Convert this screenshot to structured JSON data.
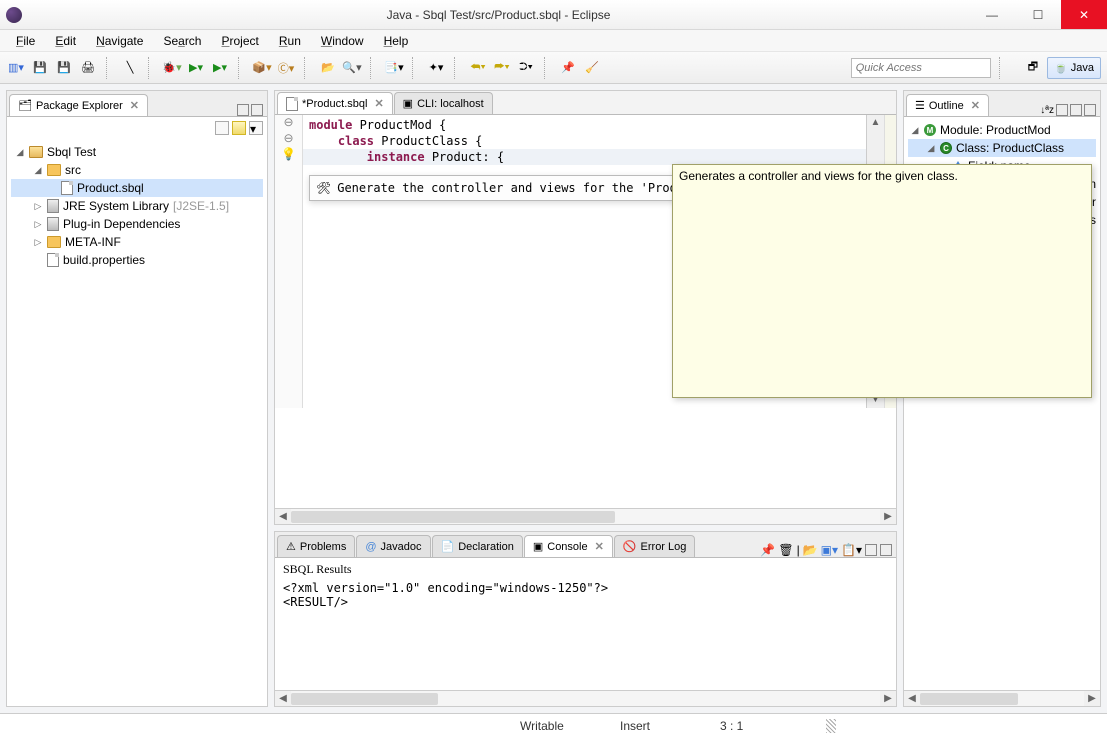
{
  "window": {
    "title": "Java - Sbql Test/src/Product.sbql - Eclipse"
  },
  "menu": [
    "File",
    "Edit",
    "Navigate",
    "Search",
    "Project",
    "Run",
    "Window",
    "Help"
  ],
  "menu_accel": [
    "F",
    "E",
    "N",
    "S",
    "P",
    "R",
    "W",
    "H"
  ],
  "quick_access_placeholder": "Quick Access",
  "perspective": {
    "label": "Java"
  },
  "package_explorer": {
    "title": "Package Explorer",
    "tree": {
      "project": "Sbql Test",
      "src": "src",
      "file": "Product.sbql",
      "jre": "JRE System Library",
      "jre_suffix": "[J2SE-1.5]",
      "plugin": "Plug-in Dependencies",
      "meta": "META-INF",
      "build": "build.properties"
    }
  },
  "editor": {
    "tabs": [
      {
        "label": "*Product.sbql",
        "active": true
      },
      {
        "label": "CLI: localhost",
        "active": false
      }
    ],
    "code": {
      "l1a": "module ",
      "l1b": "ProductMod {",
      "l2a": "class ",
      "l2b": "ProductClass {",
      "l3a": "instance ",
      "l3b": "Product: {"
    },
    "quickfix": "Generate the controller and views for the 'ProductClass' class"
  },
  "tooltip": "Generates a controller and views for the given class.",
  "outline": {
    "title": "Outline",
    "module": "Module: ProductMod",
    "class": "Class: ProductClass",
    "field1": "Field: name",
    "field2_suffix": "cription",
    "field3_suffix": "nufacturer",
    "field4_suffix": "ckItems"
  },
  "bottom": {
    "tabs": [
      "Problems",
      "Javadoc",
      "Declaration",
      "Console",
      "Error Log"
    ],
    "active_index": 3,
    "heading": "SBQL Results",
    "line1": "<?xml version=\"1.0\" encoding=\"windows-1250\"?>",
    "line2": "<RESULT/>"
  },
  "status": {
    "writable": "Writable",
    "insert": "Insert",
    "pos": "3 : 1"
  }
}
